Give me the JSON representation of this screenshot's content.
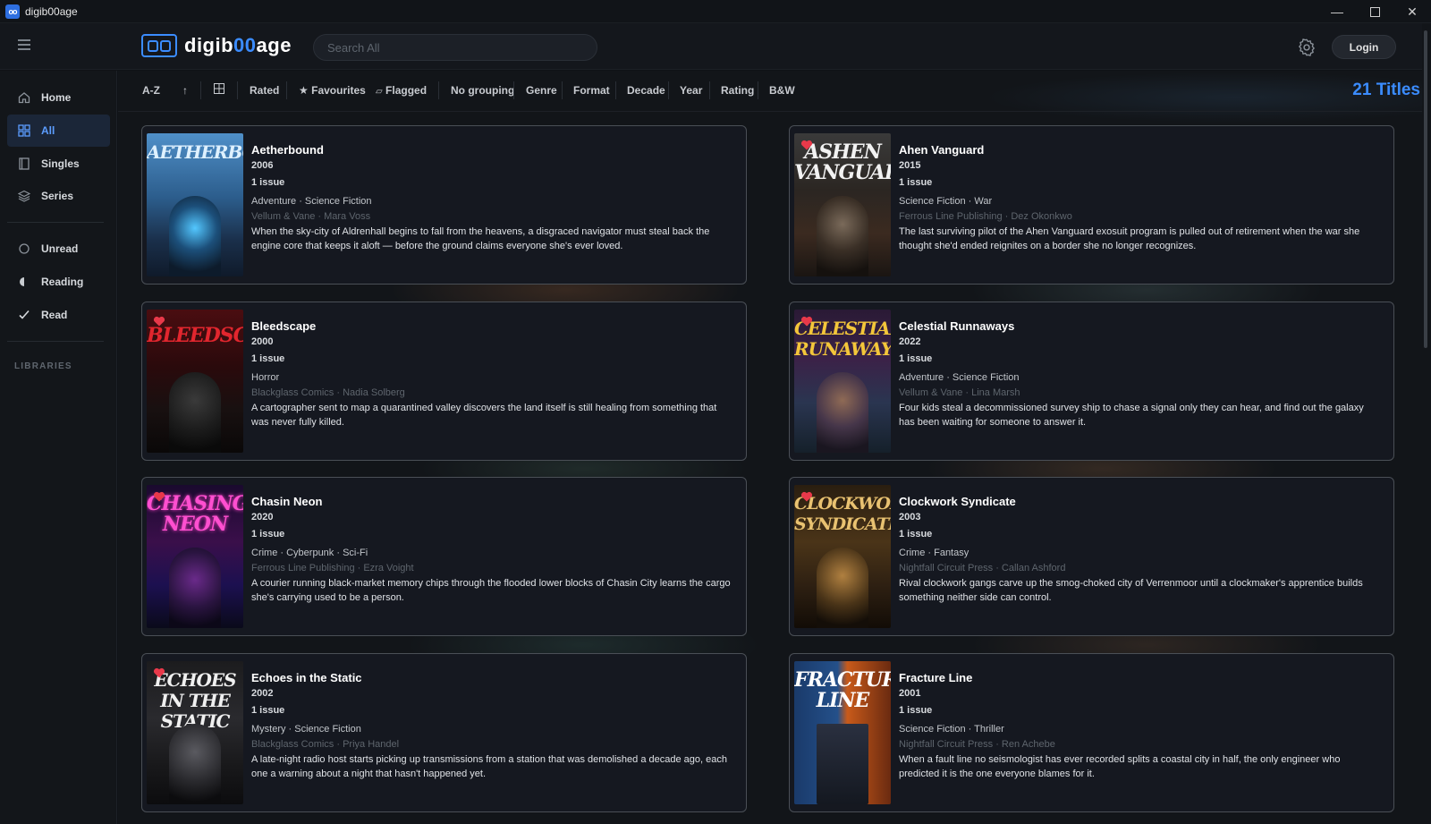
{
  "window": {
    "title": "digib00age",
    "icon": "oo"
  },
  "header": {
    "logo_pre": "digib",
    "logo_accent": "00",
    "logo_post": "age",
    "search_placeholder": "Search All",
    "login_label": "Login"
  },
  "sidebar": {
    "items": [
      {
        "label": "Home",
        "icon": "home-icon"
      },
      {
        "label": "All",
        "icon": "grid-icon"
      },
      {
        "label": "Singles",
        "icon": "book-icon"
      },
      {
        "label": "Series",
        "icon": "layers-icon"
      },
      {
        "label": "Unread",
        "icon": "circle-icon"
      },
      {
        "label": "Reading",
        "icon": "half-circle-icon"
      },
      {
        "label": "Read",
        "icon": "check-icon"
      }
    ],
    "libraries_label": "LIBRARIES"
  },
  "toolbar": {
    "sort": "A-Z",
    "direction": "↑",
    "rated": "Rated",
    "favourites": "Favourites",
    "flagged": "Flagged",
    "grouping": "No grouping",
    "genre": "Genre",
    "format": "Format",
    "decade": "Decade",
    "year": "Year",
    "rating": "Rating",
    "bw": "B&W",
    "count": "21 Titles"
  },
  "colors": {
    "accent": "#3b8cff",
    "heart": "#e8394a"
  },
  "titles": [
    {
      "title": "Aetherbound",
      "year": "2006",
      "issues": "1 issue",
      "genres": "Adventure · Science Fiction",
      "publisher": "Vellum & Vane · Mara Voss",
      "description": "When the sky-city of Aldrenhall begins to fall from the heavens, a disgraced navigator must steal back the engine core that keeps it aloft — before the ground claims everyone she's ever loved.",
      "cover_text": "AETHERBOUND",
      "favourite": false
    },
    {
      "title": "Ahen Vanguard",
      "year": "2015",
      "issues": "1 issue",
      "genres": "Science Fiction · War",
      "publisher": "Ferrous Line Publishing · Dez Okonkwo",
      "description": "The last surviving pilot of the Ahen Vanguard exosuit program is pulled out of retirement when the war she thought she'd ended reignites on a border she no longer recognizes.",
      "cover_text": "ASHEN VANGUARD",
      "favourite": true
    },
    {
      "title": "Bleedscape",
      "year": "2000",
      "issues": "1 issue",
      "genres": "Horror",
      "publisher": "Blackglass Comics · Nadia Solberg",
      "description": "A cartographer sent to map a quarantined valley discovers the land itself is still healing from something that was never fully killed.",
      "cover_text": "BLEEDSCAPE",
      "favourite": true
    },
    {
      "title": "Celestial Runnaways",
      "year": "2022",
      "issues": "1 issue",
      "genres": "Adventure · Science Fiction",
      "publisher": "Vellum & Vane · Lina Marsh",
      "description": "Four kids steal a decommissioned survey ship to chase a signal only they can hear, and find out the galaxy has been waiting for someone to answer it.",
      "cover_text": "CELESTIAL RUNAWAYS",
      "favourite": true
    },
    {
      "title": "Chasin Neon",
      "year": "2020",
      "issues": "1 issue",
      "genres": "Crime · Cyberpunk · Sci-Fi",
      "publisher": "Ferrous Line Publishing · Ezra Voight",
      "description": "A courier running black-market memory chips through the flooded lower blocks of Chasin City learns the cargo she's carrying used to be a person.",
      "cover_text": "CHASING NEON",
      "favourite": true
    },
    {
      "title": "Clockwork Syndicate",
      "year": "2003",
      "issues": "1 issue",
      "genres": "Crime · Fantasy",
      "publisher": "Nightfall Circuit Press · Callan Ashford",
      "description": "Rival clockwork gangs carve up the smog-choked city of Verrenmoor until a clockmaker's apprentice builds something neither side can control.",
      "cover_text": "CLOCKWORK SYNDICATE",
      "favourite": true
    },
    {
      "title": "Echoes in the Static",
      "year": "2002",
      "issues": "1 issue",
      "genres": "Mystery · Science Fiction",
      "publisher": "Blackglass Comics · Priya Handel",
      "description": "A late-night radio host starts picking up transmissions from a station that was demolished a decade ago, each one a warning about a night that hasn't happened yet.",
      "cover_text": "ECHOES IN THE STATIC",
      "favourite": true
    },
    {
      "title": "Fracture Line",
      "year": "2001",
      "issues": "1 issue",
      "genres": "Science Fiction · Thriller",
      "publisher": "Nightfall Circuit Press · Ren Achebe",
      "description": "When a fault line no seismologist has ever recorded splits a coastal city in half, the only engineer who predicted it is the one everyone blames for it.",
      "cover_text": "FRACTURE LINE",
      "favourite": false
    }
  ]
}
